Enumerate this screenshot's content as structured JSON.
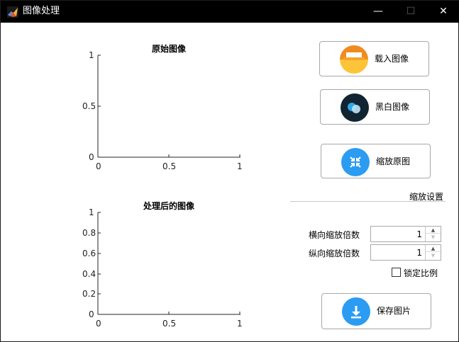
{
  "window": {
    "title": "图像处理",
    "controls": {
      "minimize": "—",
      "maximize": "☐",
      "close": "✕"
    }
  },
  "axes_top": {
    "title": "原始图像",
    "x_ticks": [
      "0",
      "0.5",
      "1"
    ],
    "y_ticks": [
      "1",
      "0.5",
      "0"
    ]
  },
  "axes_bottom": {
    "title": "处理后的图像",
    "x_ticks": [
      "0",
      "0.5",
      "1"
    ],
    "y_ticks": [
      "1",
      "0.8",
      "0.6",
      "0.4",
      "0.2",
      "0"
    ]
  },
  "buttons": {
    "load": {
      "label": "载入图像",
      "icon": "folder-icon"
    },
    "bw": {
      "label": "黑白图像",
      "icon": "circles-icon"
    },
    "restore": {
      "label": "缩放原图",
      "icon": "shrink-icon"
    },
    "save": {
      "label": "保存图片",
      "icon": "download-icon"
    }
  },
  "zoom": {
    "section_label": "缩放设置",
    "horizontal_label": "横向缩放倍数",
    "horizontal_value": "1",
    "vertical_label": "纵向缩放倍数",
    "vertical_value": "1",
    "lock_label": "锁定比例",
    "lock_checked": false
  },
  "colors": {
    "accent_blue": "#2b9cf2",
    "folder_orange": "#f08c1f",
    "folder_yellow": "#fdc43a",
    "dark_icon_bg": "#112431"
  }
}
